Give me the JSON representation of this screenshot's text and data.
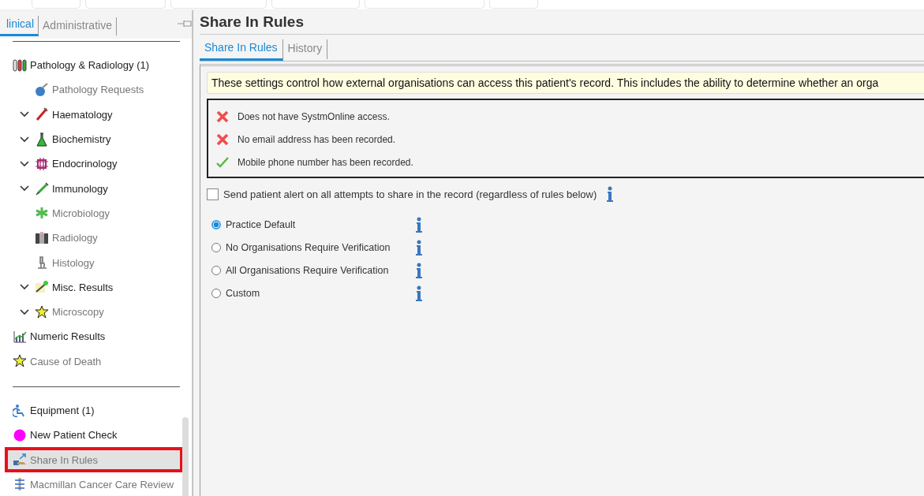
{
  "sidebar": {
    "tabs": [
      {
        "label": "linical",
        "selected": true
      },
      {
        "label": "Administrative",
        "selected": false
      }
    ],
    "sections": [
      {
        "items": [
          {
            "label": "Pathology & Radiology (1)",
            "muted": false,
            "selected": false,
            "highlighted": false,
            "expander": false,
            "children": [
              {
                "label": "Pathology Requests",
                "muted": true,
                "selected": false,
                "highlighted": false,
                "expander": false
              },
              {
                "label": "Haematology",
                "muted": false,
                "selected": false,
                "highlighted": false,
                "expander": true
              },
              {
                "label": "Biochemistry",
                "muted": false,
                "selected": false,
                "highlighted": false,
                "expander": true
              },
              {
                "label": "Endocrinology",
                "muted": false,
                "selected": false,
                "highlighted": false,
                "expander": true
              },
              {
                "label": "Immunology",
                "muted": false,
                "selected": false,
                "highlighted": false,
                "expander": true
              },
              {
                "label": "Microbiology",
                "muted": true,
                "selected": false,
                "highlighted": false,
                "expander": false
              },
              {
                "label": "Radiology",
                "muted": true,
                "selected": false,
                "highlighted": false,
                "expander": false
              },
              {
                "label": "Histology",
                "muted": true,
                "selected": false,
                "highlighted": false,
                "expander": false
              },
              {
                "label": "Misc. Results",
                "muted": false,
                "selected": false,
                "highlighted": false,
                "expander": true
              },
              {
                "label": "Microscopy",
                "muted": true,
                "selected": false,
                "highlighted": false,
                "expander": true
              }
            ]
          },
          {
            "label": "Numeric Results",
            "muted": false,
            "selected": false,
            "highlighted": false,
            "expander": false
          },
          {
            "label": "Cause of Death",
            "muted": true,
            "selected": false,
            "highlighted": false,
            "expander": false
          }
        ]
      },
      {
        "items": [
          {
            "label": "Equipment (1)",
            "muted": false,
            "selected": false,
            "highlighted": false,
            "expander": false
          },
          {
            "label": "New Patient Check",
            "muted": false,
            "selected": false,
            "highlighted": false,
            "expander": false
          },
          {
            "label": "Share In Rules",
            "muted": true,
            "selected": true,
            "highlighted": true,
            "expander": false
          },
          {
            "label": "Macmillan Cancer Care Review",
            "muted": true,
            "selected": false,
            "highlighted": false,
            "expander": false
          }
        ]
      }
    ]
  },
  "page": {
    "title": "Share In Rules",
    "tabs": [
      {
        "label": "Share In Rules",
        "selected": true
      },
      {
        "label": "History",
        "selected": false
      }
    ],
    "notice": "These settings control how external organisations can access this patient's record. This includes the ability to determine whether an orga",
    "status_items": [
      {
        "text": "Does not have SystmOnline access.",
        "ok": false
      },
      {
        "text": "No email address has been recorded.",
        "ok": false
      },
      {
        "text": "Mobile phone number has been recorded.",
        "ok": true
      }
    ],
    "alert_checkbox": {
      "label": "Send patient alert on all attempts to share in the record (regardless of rules below)",
      "checked": false
    },
    "sharing_options": [
      {
        "label": "Practice Default",
        "selected": true
      },
      {
        "label": "No Organisations Require Verification",
        "selected": false
      },
      {
        "label": "All Organisations Require Verification",
        "selected": false
      },
      {
        "label": "Custom",
        "selected": false
      }
    ]
  }
}
